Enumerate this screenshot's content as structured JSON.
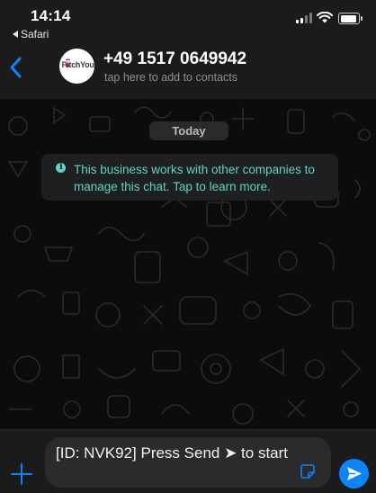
{
  "status_bar": {
    "time": "14:14",
    "back_app_label": "Safari"
  },
  "header": {
    "contact_name": "+49 1517 0649942",
    "subtitle": "tap here to add to contacts",
    "avatar_logo_text": "PitchYou"
  },
  "chat": {
    "date_label": "Today",
    "notice_text": "This business works with other companies to manage this chat. Tap to learn more."
  },
  "composer": {
    "input_value": "[ID: NVK92] Press Send ➤ to start"
  },
  "colors": {
    "accent": "#0a84ff",
    "notice_text": "#5fd3c5",
    "header_bg": "#1b1b1b",
    "chat_bg": "#0c0c0c"
  },
  "icons": [
    "back-chevron-icon",
    "info-icon",
    "plus-icon",
    "sticker-icon",
    "send-icon",
    "signal-icon",
    "wifi-icon",
    "battery-icon"
  ]
}
